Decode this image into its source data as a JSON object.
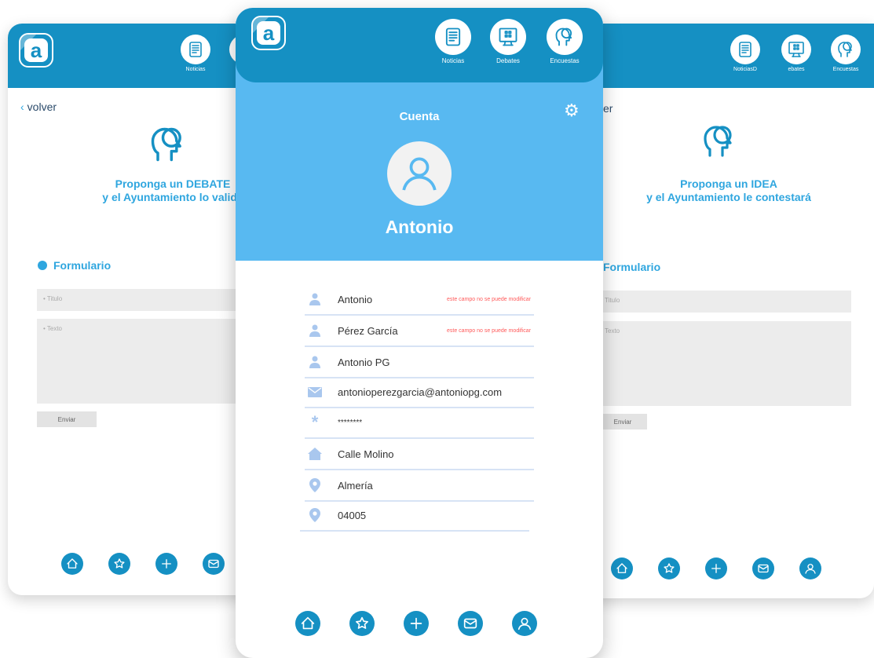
{
  "app": {
    "logo_letter": "a",
    "accent": "#1590c3",
    "light_accent": "#58b9f1",
    "text_accent": "#2fa6df"
  },
  "left_card": {
    "nav": [
      {
        "label": "Noticias",
        "icon": "newspaper-icon"
      }
    ],
    "back_label": "volver",
    "headline": [
      "Proponga un DEBATE",
      "y el Ayuntamiento lo valida"
    ],
    "form_title": "Formulario",
    "title_placeholder": "• Titulo",
    "text_placeholder": "• Texto",
    "send_label": "Enviar",
    "bottom_nav": [
      "home-icon",
      "star-icon",
      "plus-icon",
      "mail-icon"
    ]
  },
  "right_card": {
    "nav": [
      {
        "label": "NoticiasD",
        "icon": "newspaper-icon"
      },
      {
        "label": "ebates",
        "icon": "debate-board-icon"
      },
      {
        "label": "Encuestas",
        "icon": "thinking-head-icon"
      }
    ],
    "back_label": "er",
    "headline": [
      "Proponga un IDEA",
      "y el Ayuntamiento le contestará"
    ],
    "form_title": "Formulario",
    "title_placeholder": "Titulo",
    "text_placeholder": "Texto",
    "send_label": "Enviar",
    "bottom_nav": [
      "home-icon",
      "star-icon",
      "plus-icon",
      "mail-icon",
      "user-icon"
    ]
  },
  "center_card": {
    "nav": [
      {
        "label": "Noticias",
        "icon": "newspaper-icon"
      },
      {
        "label": "Debates",
        "icon": "debate-board-icon"
      },
      {
        "label": "Encuestas",
        "icon": "thinking-head-icon"
      }
    ],
    "section_title": "Cuenta",
    "user_name": "Antonio",
    "fields": [
      {
        "icon": "person-icon",
        "value": "Antonio",
        "note": "este campo no se puede modificar"
      },
      {
        "icon": "person-icon",
        "value": "Pérez García",
        "note": "este campo no se puede modificar"
      },
      {
        "icon": "person-icon",
        "value": "Antonio PG",
        "note": ""
      },
      {
        "icon": "envelope-icon",
        "value": "antonioperezgarcia@antoniopg.com",
        "note": ""
      },
      {
        "icon": "asterisk-icon",
        "value": "********",
        "note": ""
      },
      {
        "icon": "house-icon",
        "value": "Calle Molino",
        "note": ""
      },
      {
        "icon": "location-pin-icon",
        "value": "Almería",
        "note": ""
      },
      {
        "icon": "location-pin-icon",
        "value": "04005",
        "note": ""
      }
    ],
    "bottom_nav": [
      "home-icon",
      "star-icon",
      "plus-icon",
      "mail-icon",
      "user-icon"
    ]
  }
}
